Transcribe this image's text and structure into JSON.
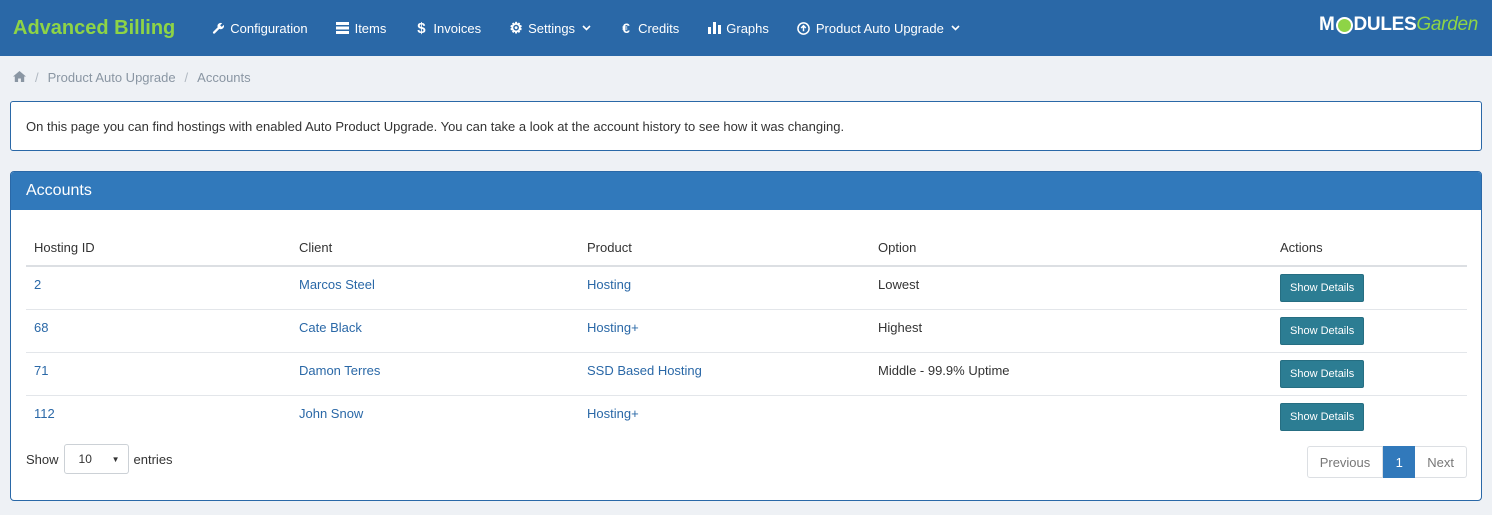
{
  "navbar": {
    "brand": "Advanced Billing",
    "items": [
      {
        "label": "Configuration",
        "icon": "wrench-icon"
      },
      {
        "label": "Items",
        "icon": "list-icon"
      },
      {
        "label": "Invoices",
        "icon": "dollar-icon"
      },
      {
        "label": "Settings",
        "icon": "gear-icon",
        "dropdown": true
      },
      {
        "label": "Credits",
        "icon": "euro-icon"
      },
      {
        "label": "Graphs",
        "icon": "bar-chart-icon"
      },
      {
        "label": "Product Auto Upgrade",
        "icon": "arrow-up-circle-icon",
        "dropdown": true
      }
    ],
    "logo": {
      "part1": "M",
      "part2": "DULES",
      "part3": "Garden"
    }
  },
  "breadcrumb": {
    "items": [
      "Product Auto Upgrade",
      "Accounts"
    ]
  },
  "info": {
    "text": "On this page you can find hostings with enabled Auto Product Upgrade. You can take a look at the account history to see how it was changing."
  },
  "panel": {
    "title": "Accounts",
    "columns": [
      "Hosting ID",
      "Client",
      "Product",
      "Option",
      "Actions"
    ],
    "rows": [
      {
        "id": "2",
        "client": "Marcos Steel",
        "product": "Hosting",
        "option": "Lowest",
        "action": "Show Details"
      },
      {
        "id": "68",
        "client": "Cate Black",
        "product": "Hosting+",
        "option": "Highest",
        "action": "Show Details"
      },
      {
        "id": "71",
        "client": "Damon Terres",
        "product": "SSD Based Hosting",
        "option": "Middle - 99.9% Uptime",
        "action": "Show Details"
      },
      {
        "id": "112",
        "client": "John Snow",
        "product": "Hosting+",
        "option": "",
        "action": "Show Details"
      }
    ],
    "footer": {
      "show_label": "Show",
      "entries_value": "10",
      "entries_label": "entries",
      "prev_label": "Previous",
      "page": "1",
      "next_label": "Next"
    }
  },
  "colors": {
    "navbar": "#2a68a7",
    "brand": "#8ed446",
    "panel_header": "#3179bb",
    "button": "#2c7d93"
  }
}
